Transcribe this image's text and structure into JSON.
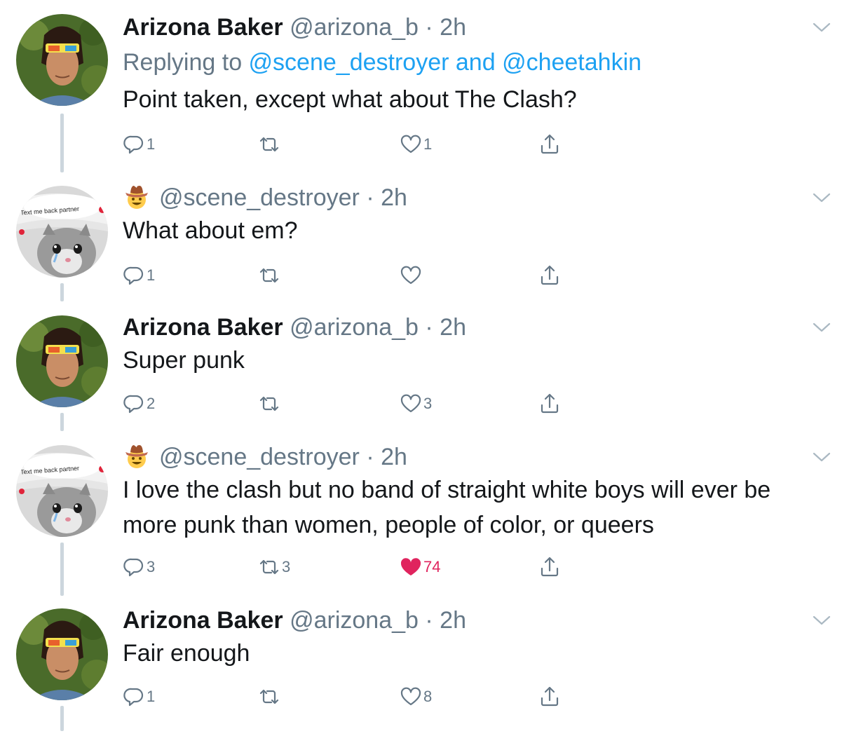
{
  "tweets": [
    {
      "name": "Arizona Baker",
      "handle": "@arizona_b",
      "time": "2h",
      "reply_prefix": "Replying to ",
      "reply_mention_1": "@scene_destroyer",
      "reply_and": " and ",
      "reply_mention_2": "@cheetahkin",
      "text": "Point taken, except what about The Clash?",
      "replies": "1",
      "retweets": "",
      "likes": "1"
    },
    {
      "handle": "@scene_destroyer",
      "time": "2h",
      "text": "What about em?",
      "replies": "1",
      "retweets": "",
      "likes": ""
    },
    {
      "name": "Arizona Baker",
      "handle": "@arizona_b",
      "time": "2h",
      "text": "Super punk",
      "replies": "2",
      "retweets": "",
      "likes": "3"
    },
    {
      "handle": "@scene_destroyer",
      "time": "2h",
      "text": "I love the clash but no band of straight white boys will ever be more punk than women, people of color, or queers",
      "replies": "3",
      "retweets": "3",
      "likes": "74",
      "liked": true
    },
    {
      "name": "Arizona Baker",
      "handle": "@arizona_b",
      "time": "2h",
      "text": "Fair enough",
      "replies": "1",
      "retweets": "",
      "likes": "8"
    }
  ],
  "avatar_text": "Text me back partner",
  "icons": {
    "reply": "reply-icon",
    "retweet": "retweet-icon",
    "like": "heart-icon",
    "share": "share-icon",
    "caret": "chevron-down-icon",
    "cowboy": "cowboy-emoji-icon"
  },
  "colors": {
    "text": "#14171a",
    "secondary": "#657786",
    "link": "#1da1f2",
    "like": "#e0245e",
    "thread_line": "#ccd6dd"
  }
}
